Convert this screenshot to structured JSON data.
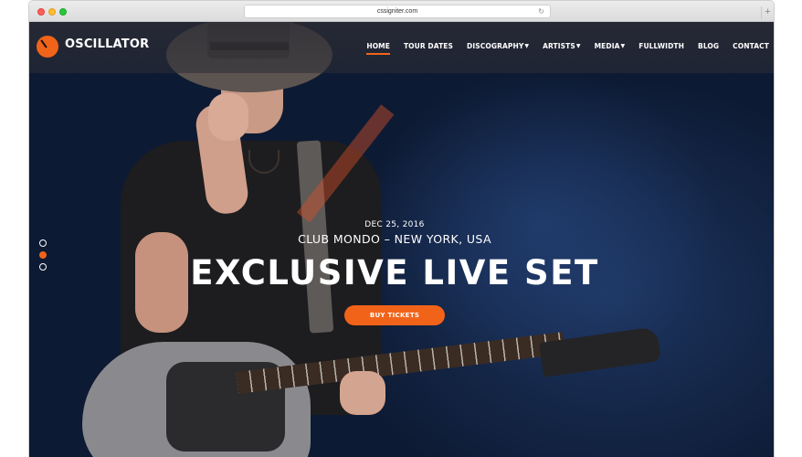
{
  "browser": {
    "url": "cssigniter.com",
    "reload_icon": "reload-icon",
    "new_tab_icon": "plus-icon"
  },
  "site": {
    "logo_text": "OSCILLATOR",
    "nav": [
      {
        "label": "HOME",
        "active": true,
        "dropdown": false
      },
      {
        "label": "TOUR DATES",
        "active": false,
        "dropdown": false
      },
      {
        "label": "DISCOGRAPHY",
        "active": false,
        "dropdown": true
      },
      {
        "label": "ARTISTS",
        "active": false,
        "dropdown": true
      },
      {
        "label": "MEDIA",
        "active": false,
        "dropdown": true
      },
      {
        "label": "FULLWIDTH",
        "active": false,
        "dropdown": false
      },
      {
        "label": "BLOG",
        "active": false,
        "dropdown": false
      },
      {
        "label": "CONTACT",
        "active": false,
        "dropdown": false
      }
    ]
  },
  "hero": {
    "date": "DEC 25, 2016",
    "venue": "CLUB MONDO – NEW YORK, USA",
    "headline": "EXCLUSIVE LIVE SET",
    "cta_label": "BUY TICKETS"
  },
  "slider": {
    "slide_count": 3,
    "active_index": 1
  },
  "colors": {
    "accent": "#f2631a",
    "background": "#0d1a33",
    "nav_overlay": "#2d2d34"
  }
}
